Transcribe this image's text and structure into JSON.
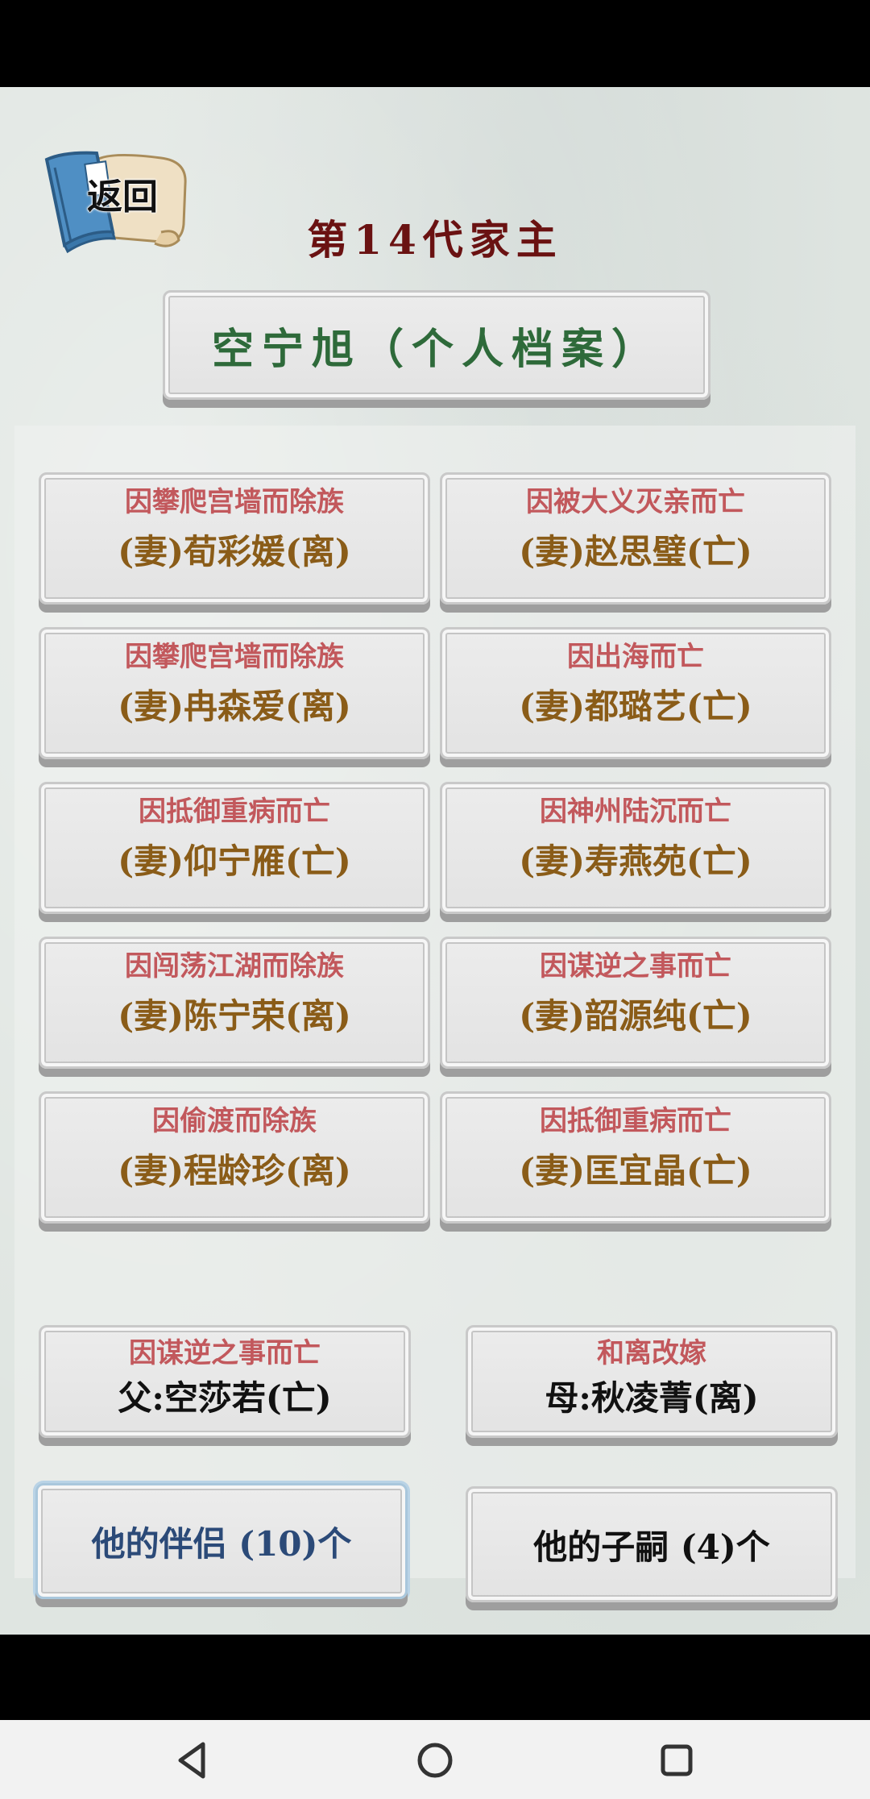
{
  "header": {
    "back_label": "返回",
    "generation": "第14代家主",
    "profile_name": "空宁旭（个人档案）"
  },
  "spouses": [
    {
      "cause": "因攀爬宫墙而除族",
      "name": "(妻)荀彩媛(离)"
    },
    {
      "cause": "因被大义灭亲而亡",
      "name": "(妻)赵思璧(亡)"
    },
    {
      "cause": "因攀爬宫墙而除族",
      "name": "(妻)冉森爱(离)"
    },
    {
      "cause": "因出海而亡",
      "name": "(妻)都璐艺(亡)"
    },
    {
      "cause": "因抵御重病而亡",
      "name": "(妻)仰宁雁(亡)"
    },
    {
      "cause": "因神州陆沉而亡",
      "name": "(妻)寿燕苑(亡)"
    },
    {
      "cause": "因闯荡江湖而除族",
      "name": "(妻)陈宁荣(离)"
    },
    {
      "cause": "因谋逆之事而亡",
      "name": "(妻)韶源纯(亡)"
    },
    {
      "cause": "因偷渡而除族",
      "name": "(妻)程龄珍(离)"
    },
    {
      "cause": "因抵御重病而亡",
      "name": "(妻)匡宜晶(亡)"
    }
  ],
  "parents": {
    "father": {
      "cause": "因谋逆之事而亡",
      "name": "父:空莎若(亡)"
    },
    "mother": {
      "cause": "和离改嫁",
      "name": "母:秋凌菁(离)"
    }
  },
  "tabs": {
    "partners": "他的伴侣 (10)个",
    "children": "他的子嗣 (4)个"
  },
  "colors": {
    "generation": "#6a1212",
    "profile_name": "#2e6a3a",
    "cause": "#c2585c",
    "spouse_name": "#8a5c18",
    "active_tab": "#2b4a78"
  },
  "nav_icons": [
    "back-triangle-icon",
    "home-circle-icon",
    "recents-square-icon"
  ]
}
